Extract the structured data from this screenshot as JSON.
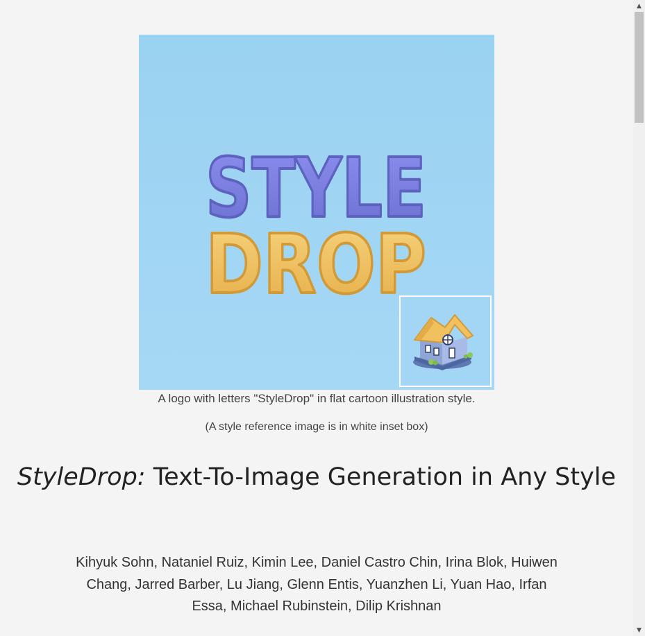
{
  "hero": {
    "logo_text_line1": "STYLE",
    "logo_text_line2": "DROP"
  },
  "captions": {
    "main": "A logo with letters \"StyleDrop\" in flat cartoon illustration style.",
    "sub": "(A style reference image is in white inset box)"
  },
  "title": {
    "emphasis": "StyleDrop:",
    "rest": " Text-To-Image Generation in Any Style"
  },
  "authors": "Kihyuk Sohn, Nataniel Ruiz, Kimin Lee, Daniel Castro Chin, Irina Blok, Huiwen Chang, Jarred Barber, Lu Jiang, Glenn Entis, Yuanzhen Li, Yuan Hao, Irfan Essa, Michael Rubinstein, Dilip Krishnan",
  "colors": {
    "hero_background": "#9ed3f2",
    "logo_top": "#7a7fd8",
    "logo_bottom": "#f0c15e",
    "inset_border": "#ffffff"
  },
  "icons": {
    "scroll_up": "triangle-up-icon",
    "scroll_down": "triangle-down-icon",
    "inset": "house-icon"
  }
}
